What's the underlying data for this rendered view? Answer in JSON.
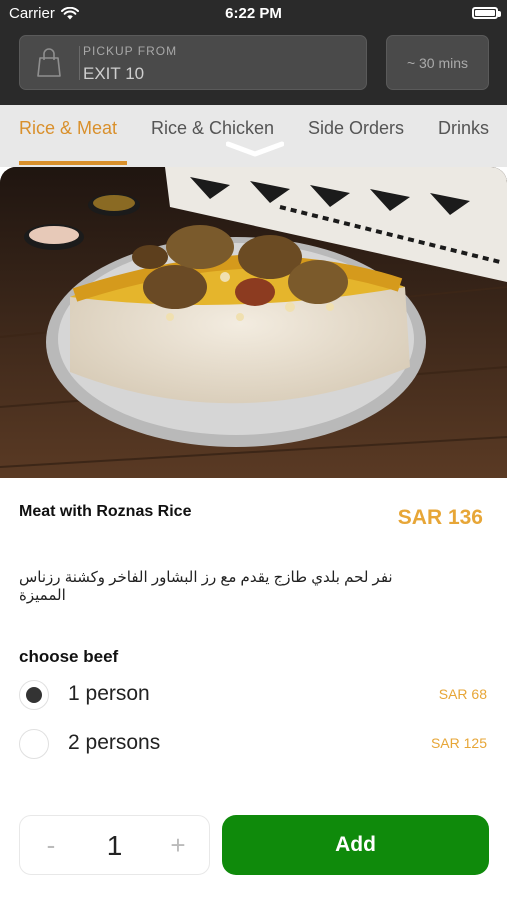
{
  "status_bar": {
    "carrier": "Carrier",
    "time": "6:22 PM"
  },
  "pickup": {
    "label": "PICKUP FROM",
    "location": "EXIT 10",
    "eta": "~ 30 mins"
  },
  "tabs": [
    {
      "label": "Rice & Meat",
      "active": true
    },
    {
      "label": "Rice & Chicken",
      "active": false
    },
    {
      "label": "Side Orders",
      "active": false
    },
    {
      "label": "Drinks",
      "active": false
    }
  ],
  "product": {
    "name": "Meat with Roznas Rice",
    "price": "SAR 136",
    "description": "نفر لحم بلدي طازج يقدم مع رز البشاور الفاخر وكشنة رزناس المميزة"
  },
  "options_group": {
    "title": "choose beef",
    "options": [
      {
        "label": "1 person",
        "price": "SAR 68",
        "selected": true
      },
      {
        "label": "2 persons",
        "price": "SAR 125",
        "selected": false
      }
    ]
  },
  "cart": {
    "quantity": "1",
    "minus": "-",
    "plus": "+",
    "add_label": "Add"
  },
  "colors": {
    "accent": "#d9902c",
    "price": "#e7a637",
    "add_button": "#0f8a0b",
    "header": "#2a2a2a"
  }
}
